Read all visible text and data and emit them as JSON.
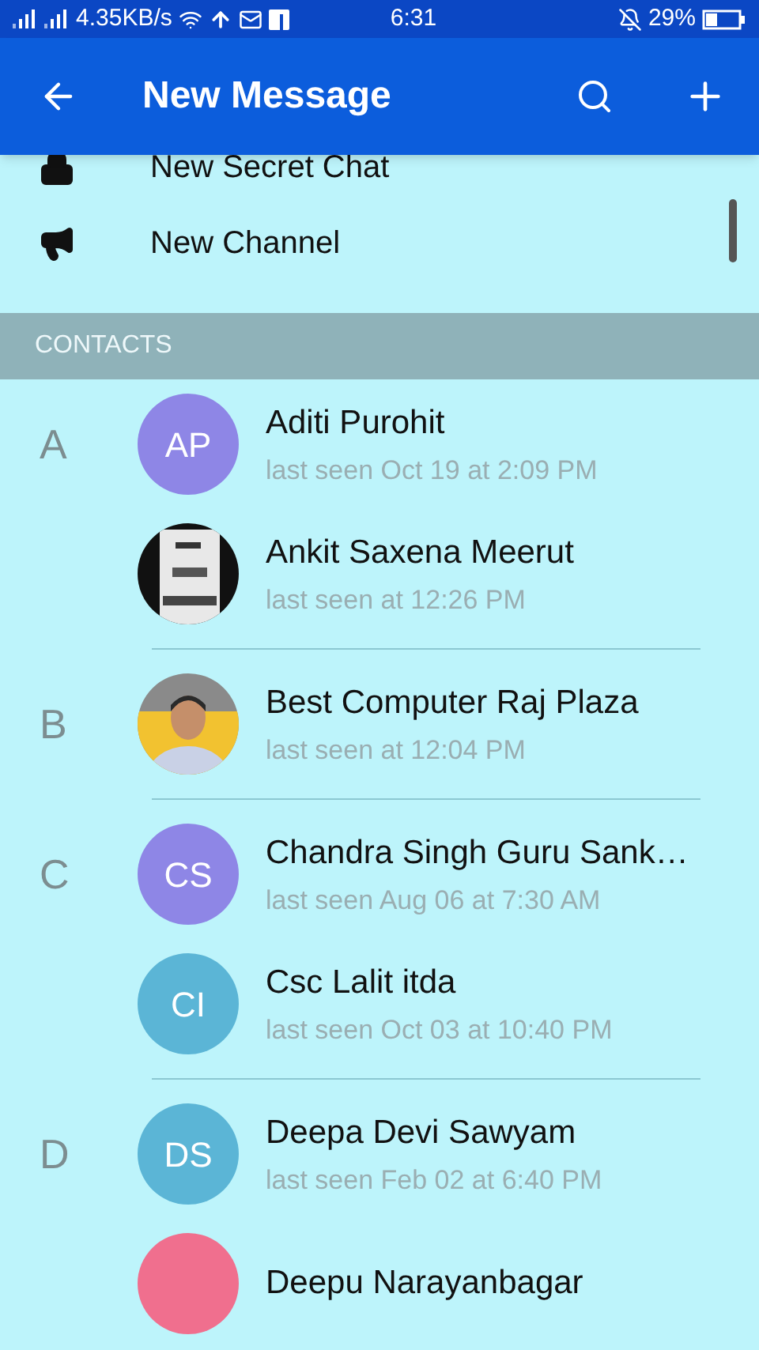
{
  "status_bar": {
    "speed": "4.35KB/s",
    "time": "6:31",
    "battery": "29%"
  },
  "header": {
    "title": "New Message"
  },
  "menu": [
    {
      "label": "New Secret Chat",
      "kind": "lock"
    },
    {
      "label": "New Channel",
      "kind": "megaphone"
    }
  ],
  "contacts_header": "CONTACTS",
  "sections": [
    {
      "letter": "A",
      "contacts": [
        {
          "name": "Aditi Purohit",
          "status": "last seen Oct 19 at 2:09 PM",
          "avatar": {
            "kind": "initials",
            "initials": "AP",
            "color": "#8e86e6"
          }
        },
        {
          "name": "Ankit Saxena Meerut",
          "status": "last seen at 12:26 PM"
        }
      ]
    },
    {
      "letter": "B",
      "contacts": [
        {
          "name": "Best Computer Raj Plaza",
          "status": "last seen at 12:04 PM"
        }
      ]
    },
    {
      "letter": "C",
      "contacts": [
        {
          "name": "Chandra Singh Guru Sank…",
          "status": "last seen Aug 06 at 7:30 AM",
          "avatar": {
            "kind": "initials",
            "initials": "CS",
            "color": "#8e86e6"
          }
        },
        {
          "name": "Csc Lalit itda",
          "status": "last seen Oct 03 at 10:40 PM",
          "avatar": {
            "kind": "initials",
            "initials": "CI",
            "color": "#5bb5d6"
          }
        }
      ]
    },
    {
      "letter": "D",
      "contacts": [
        {
          "name": "Deepa Devi Sawyam",
          "status": "last seen Feb 02 at 6:40 PM",
          "avatar": {
            "kind": "initials",
            "initials": "DS",
            "color": "#5bb5d6"
          }
        },
        {
          "name": "Deepu Narayanbagar",
          "avatar": {
            "kind": "initials",
            "color": "#f06f8e"
          }
        }
      ]
    }
  ]
}
